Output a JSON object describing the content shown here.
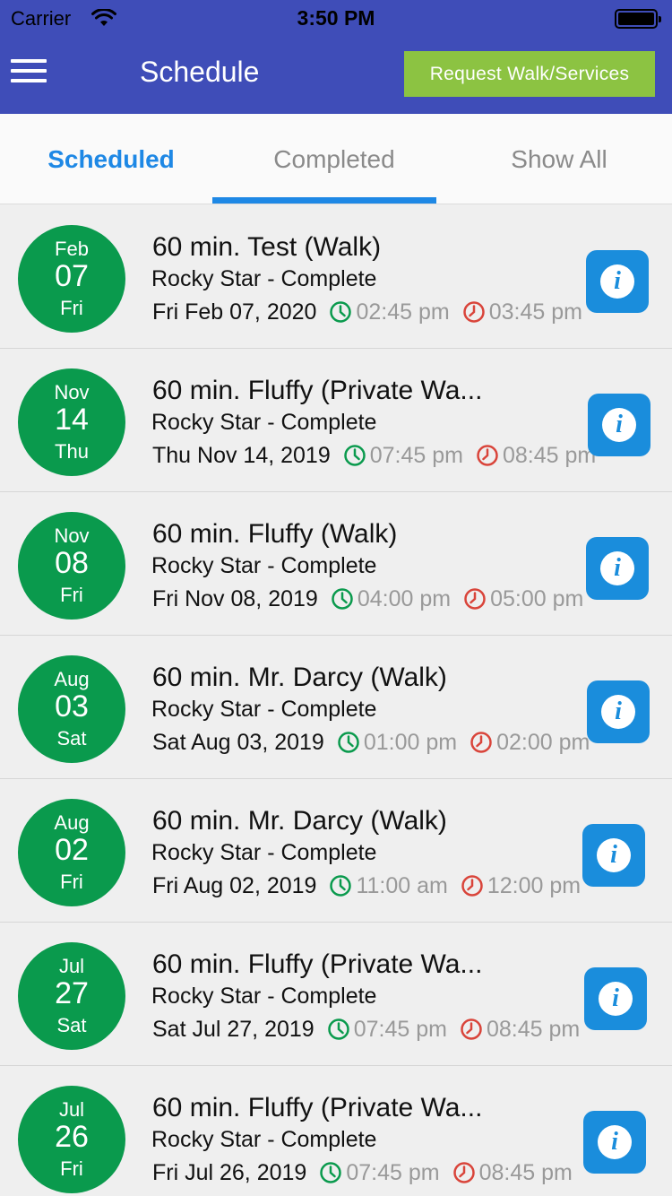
{
  "status_bar": {
    "carrier": "Carrier",
    "time": "3:50 PM"
  },
  "header": {
    "title": "Schedule",
    "request_button": "Request Walk/Services"
  },
  "tabs": [
    {
      "label": "Scheduled",
      "active": true
    },
    {
      "label": "Completed",
      "active": false
    },
    {
      "label": "Show All",
      "active": false
    }
  ],
  "colors": {
    "header": "#3f4db8",
    "request_button": "#8cc342",
    "tab_active": "#1e88e5",
    "date_circle": "#0a9a4d",
    "start_time_icon": "#0a9a4d",
    "end_time_icon": "#d9443a",
    "info_button": "#1a8ddc"
  },
  "icons": {
    "menu": "hamburger-menu-icon",
    "start": "clock-icon-green",
    "end": "clock-icon-red",
    "info": "info-icon"
  },
  "appointments": [
    {
      "month": "Feb",
      "day": "07",
      "weekday": "Fri",
      "title": "60 min. Test (Walk)",
      "subtitle": "Rocky Star - Complete",
      "date": "Fri Feb 07, 2020",
      "start": "02:45 pm",
      "end": "03:45 pm"
    },
    {
      "month": "Nov",
      "day": "14",
      "weekday": "Thu",
      "title": "60 min. Fluffy (Private Wa...",
      "subtitle": "Rocky Star - Complete",
      "date": "Thu Nov 14, 2019",
      "start": "07:45 pm",
      "end": "08:45 pm"
    },
    {
      "month": "Nov",
      "day": "08",
      "weekday": "Fri",
      "title": "60 min. Fluffy  (Walk)",
      "subtitle": "Rocky Star - Complete",
      "date": "Fri Nov 08, 2019",
      "start": "04:00 pm",
      "end": "05:00 pm"
    },
    {
      "month": "Aug",
      "day": "03",
      "weekday": "Sat",
      "title": "60 min. Mr. Darcy (Walk)",
      "subtitle": "Rocky Star - Complete",
      "date": "Sat Aug 03, 2019",
      "start": "01:00 pm",
      "end": "02:00 pm"
    },
    {
      "month": "Aug",
      "day": "02",
      "weekday": "Fri",
      "title": "60 min. Mr. Darcy (Walk)",
      "subtitle": "Rocky Star - Complete",
      "date": "Fri Aug 02, 2019",
      "start": "11:00 am",
      "end": "12:00 pm"
    },
    {
      "month": "Jul",
      "day": "27",
      "weekday": "Sat",
      "title": "60 min. Fluffy (Private Wa...",
      "subtitle": "Rocky Star - Complete",
      "date": "Sat Jul 27, 2019",
      "start": "07:45 pm",
      "end": "08:45 pm"
    },
    {
      "month": "Jul",
      "day": "26",
      "weekday": "Fri",
      "title": "60 min. Fluffy (Private Wa...",
      "subtitle": "Rocky Star - Complete",
      "date": "Fri Jul 26, 2019",
      "start": "07:45 pm",
      "end": "08:45 pm"
    }
  ]
}
